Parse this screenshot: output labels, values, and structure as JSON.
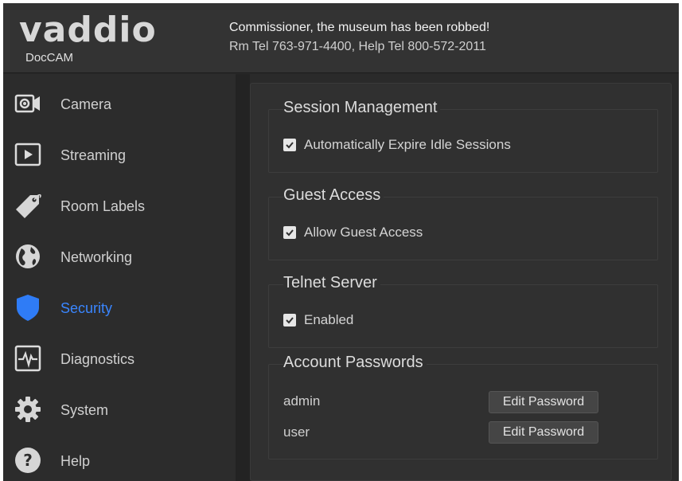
{
  "brand": {
    "logo": "vaddio",
    "product": "DocCAM"
  },
  "header": {
    "room_label": "Commissioner, the museum has been robbed!",
    "contact": "Rm Tel 763-971-4400, Help Tel 800-572-2011"
  },
  "sidebar": {
    "items": [
      {
        "label": "Camera",
        "icon": "camera-icon"
      },
      {
        "label": "Streaming",
        "icon": "play-icon"
      },
      {
        "label": "Room Labels",
        "icon": "tag-icon"
      },
      {
        "label": "Networking",
        "icon": "globe-icon"
      },
      {
        "label": "Security",
        "icon": "shield-icon",
        "active": true
      },
      {
        "label": "Diagnostics",
        "icon": "pulse-icon"
      },
      {
        "label": "System",
        "icon": "gear-icon"
      },
      {
        "label": "Help",
        "icon": "help-icon"
      }
    ],
    "active_color": "#3a86ff"
  },
  "security": {
    "session": {
      "title": "Session Management",
      "option": "Automatically Expire Idle Sessions",
      "checked": true
    },
    "guest": {
      "title": "Guest Access",
      "option": "Allow Guest Access",
      "checked": true
    },
    "telnet": {
      "title": "Telnet Server",
      "option": "Enabled",
      "checked": true
    },
    "passwords": {
      "title": "Account Passwords",
      "accounts": [
        {
          "name": "admin",
          "button": "Edit Password"
        },
        {
          "name": "user",
          "button": "Edit Password"
        }
      ]
    }
  }
}
